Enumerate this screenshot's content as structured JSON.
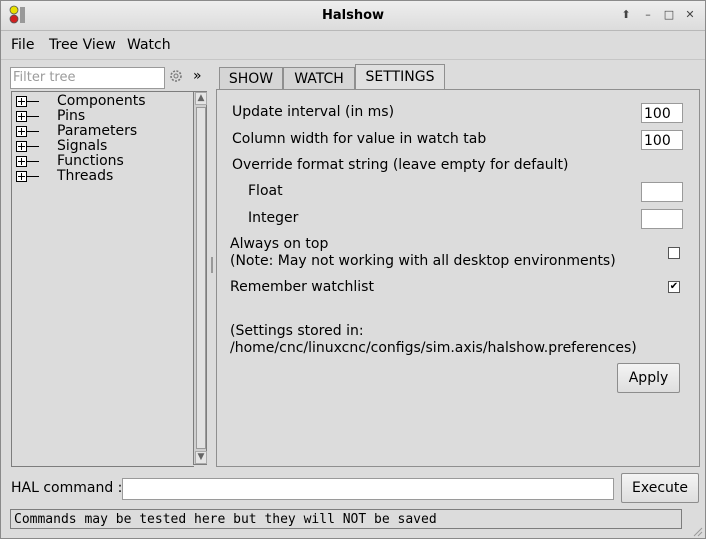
{
  "window": {
    "title": "Halshow"
  },
  "menubar": {
    "items": [
      "File",
      "Tree View",
      "Watch"
    ]
  },
  "filter": {
    "placeholder": "Filter tree",
    "expand_glyph": "»"
  },
  "tree": {
    "items": [
      "Components",
      "Pins",
      "Parameters",
      "Signals",
      "Functions",
      "Threads"
    ]
  },
  "tabs": {
    "items": [
      "SHOW",
      "WATCH",
      "SETTINGS"
    ],
    "active": "SETTINGS"
  },
  "settings": {
    "update_interval_label": "Update interval (in ms)",
    "update_interval_value": "100",
    "column_width_label": "Column width for value in watch tab",
    "column_width_value": "100",
    "override_format_label": "Override format string (leave empty for default)",
    "float_label": "Float",
    "float_value": "",
    "integer_label": "Integer",
    "integer_value": "",
    "always_on_top_label": "Always on top",
    "always_on_top_note": "(Note: May not working with all desktop environments)",
    "always_on_top_checked": false,
    "remember_watchlist_label": "Remember watchlist",
    "remember_watchlist_checked": true,
    "stored_in_label": "(Settings stored in:",
    "stored_in_path": "/home/cnc/linuxcnc/configs/sim.axis/halshow.preferences)",
    "apply_label": "Apply"
  },
  "halcommand": {
    "label": "HAL command :",
    "value": "",
    "execute_label": "Execute"
  },
  "status": {
    "message": "Commands may be tested here but they will NOT be saved"
  },
  "icons": [
    "app-icon",
    "maximize-arrow-icon",
    "minimize-icon",
    "restore-icon",
    "close-icon",
    "gear-icon",
    "scroll-up-icon",
    "scroll-down-icon",
    "resize-grip-icon"
  ],
  "colors": {
    "window_bg": "#dcdcdc",
    "field_bg": "#ffffff"
  }
}
